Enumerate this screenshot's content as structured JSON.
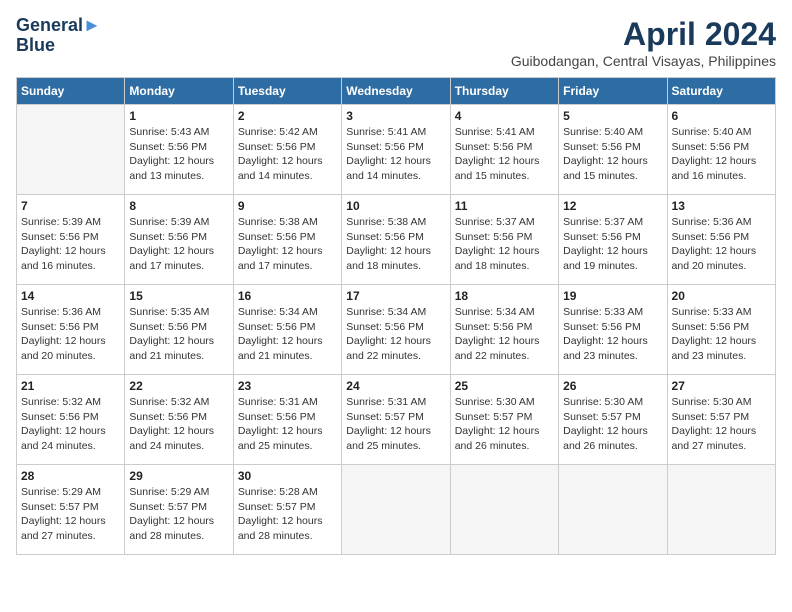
{
  "logo": {
    "line1": "General",
    "line2": "Blue"
  },
  "title": "April 2024",
  "location": "Guibodangan, Central Visayas, Philippines",
  "days_of_week": [
    "Sunday",
    "Monday",
    "Tuesday",
    "Wednesday",
    "Thursday",
    "Friday",
    "Saturday"
  ],
  "weeks": [
    [
      {
        "num": "",
        "info": ""
      },
      {
        "num": "1",
        "info": "Sunrise: 5:43 AM\nSunset: 5:56 PM\nDaylight: 12 hours\nand 13 minutes."
      },
      {
        "num": "2",
        "info": "Sunrise: 5:42 AM\nSunset: 5:56 PM\nDaylight: 12 hours\nand 14 minutes."
      },
      {
        "num": "3",
        "info": "Sunrise: 5:41 AM\nSunset: 5:56 PM\nDaylight: 12 hours\nand 14 minutes."
      },
      {
        "num": "4",
        "info": "Sunrise: 5:41 AM\nSunset: 5:56 PM\nDaylight: 12 hours\nand 15 minutes."
      },
      {
        "num": "5",
        "info": "Sunrise: 5:40 AM\nSunset: 5:56 PM\nDaylight: 12 hours\nand 15 minutes."
      },
      {
        "num": "6",
        "info": "Sunrise: 5:40 AM\nSunset: 5:56 PM\nDaylight: 12 hours\nand 16 minutes."
      }
    ],
    [
      {
        "num": "7",
        "info": "Sunrise: 5:39 AM\nSunset: 5:56 PM\nDaylight: 12 hours\nand 16 minutes."
      },
      {
        "num": "8",
        "info": "Sunrise: 5:39 AM\nSunset: 5:56 PM\nDaylight: 12 hours\nand 17 minutes."
      },
      {
        "num": "9",
        "info": "Sunrise: 5:38 AM\nSunset: 5:56 PM\nDaylight: 12 hours\nand 17 minutes."
      },
      {
        "num": "10",
        "info": "Sunrise: 5:38 AM\nSunset: 5:56 PM\nDaylight: 12 hours\nand 18 minutes."
      },
      {
        "num": "11",
        "info": "Sunrise: 5:37 AM\nSunset: 5:56 PM\nDaylight: 12 hours\nand 18 minutes."
      },
      {
        "num": "12",
        "info": "Sunrise: 5:37 AM\nSunset: 5:56 PM\nDaylight: 12 hours\nand 19 minutes."
      },
      {
        "num": "13",
        "info": "Sunrise: 5:36 AM\nSunset: 5:56 PM\nDaylight: 12 hours\nand 20 minutes."
      }
    ],
    [
      {
        "num": "14",
        "info": "Sunrise: 5:36 AM\nSunset: 5:56 PM\nDaylight: 12 hours\nand 20 minutes."
      },
      {
        "num": "15",
        "info": "Sunrise: 5:35 AM\nSunset: 5:56 PM\nDaylight: 12 hours\nand 21 minutes."
      },
      {
        "num": "16",
        "info": "Sunrise: 5:34 AM\nSunset: 5:56 PM\nDaylight: 12 hours\nand 21 minutes."
      },
      {
        "num": "17",
        "info": "Sunrise: 5:34 AM\nSunset: 5:56 PM\nDaylight: 12 hours\nand 22 minutes."
      },
      {
        "num": "18",
        "info": "Sunrise: 5:34 AM\nSunset: 5:56 PM\nDaylight: 12 hours\nand 22 minutes."
      },
      {
        "num": "19",
        "info": "Sunrise: 5:33 AM\nSunset: 5:56 PM\nDaylight: 12 hours\nand 23 minutes."
      },
      {
        "num": "20",
        "info": "Sunrise: 5:33 AM\nSunset: 5:56 PM\nDaylight: 12 hours\nand 23 minutes."
      }
    ],
    [
      {
        "num": "21",
        "info": "Sunrise: 5:32 AM\nSunset: 5:56 PM\nDaylight: 12 hours\nand 24 minutes."
      },
      {
        "num": "22",
        "info": "Sunrise: 5:32 AM\nSunset: 5:56 PM\nDaylight: 12 hours\nand 24 minutes."
      },
      {
        "num": "23",
        "info": "Sunrise: 5:31 AM\nSunset: 5:56 PM\nDaylight: 12 hours\nand 25 minutes."
      },
      {
        "num": "24",
        "info": "Sunrise: 5:31 AM\nSunset: 5:57 PM\nDaylight: 12 hours\nand 25 minutes."
      },
      {
        "num": "25",
        "info": "Sunrise: 5:30 AM\nSunset: 5:57 PM\nDaylight: 12 hours\nand 26 minutes."
      },
      {
        "num": "26",
        "info": "Sunrise: 5:30 AM\nSunset: 5:57 PM\nDaylight: 12 hours\nand 26 minutes."
      },
      {
        "num": "27",
        "info": "Sunrise: 5:30 AM\nSunset: 5:57 PM\nDaylight: 12 hours\nand 27 minutes."
      }
    ],
    [
      {
        "num": "28",
        "info": "Sunrise: 5:29 AM\nSunset: 5:57 PM\nDaylight: 12 hours\nand 27 minutes."
      },
      {
        "num": "29",
        "info": "Sunrise: 5:29 AM\nSunset: 5:57 PM\nDaylight: 12 hours\nand 28 minutes."
      },
      {
        "num": "30",
        "info": "Sunrise: 5:28 AM\nSunset: 5:57 PM\nDaylight: 12 hours\nand 28 minutes."
      },
      {
        "num": "",
        "info": ""
      },
      {
        "num": "",
        "info": ""
      },
      {
        "num": "",
        "info": ""
      },
      {
        "num": "",
        "info": ""
      }
    ]
  ]
}
